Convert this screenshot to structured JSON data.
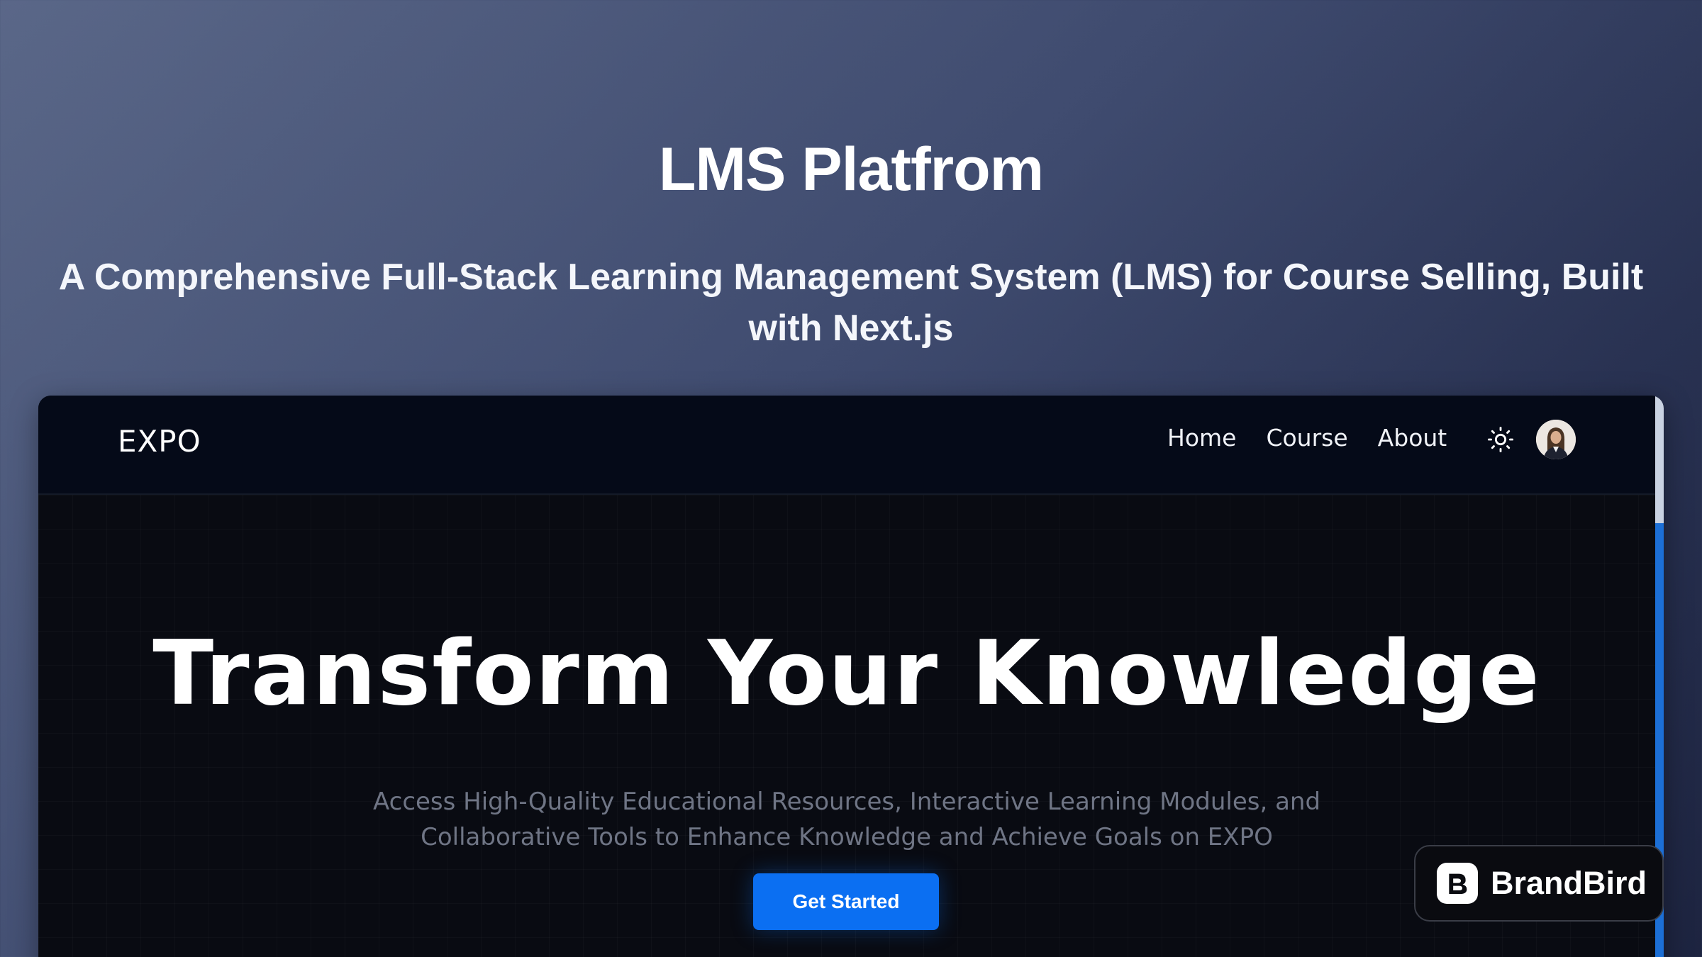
{
  "hero": {
    "title": "LMS Platfrom",
    "subtitle": "A Comprehensive Full-Stack Learning Management System (LMS) for Course Selling, Built with Next.js"
  },
  "site": {
    "logo": "EXPO",
    "nav": {
      "items": [
        {
          "label": "Home"
        },
        {
          "label": "Course"
        },
        {
          "label": "About"
        }
      ],
      "theme_icon": "sun-icon",
      "avatar_icon": "user-avatar"
    },
    "main": {
      "heading": "Transform Your Knowledge",
      "description": "Access High-Quality Educational Resources, Interactive Learning Modules, and Collaborative Tools to Enhance Knowledge and Achieve Goals on EXPO",
      "cta_label": "Get Started"
    },
    "colors": {
      "accent": "#0b6ff2",
      "nav_bg": "#050a18",
      "body_bg": "#090b12"
    }
  },
  "badge": {
    "name": "BrandBird",
    "icon": "brandbird-logo-icon"
  }
}
